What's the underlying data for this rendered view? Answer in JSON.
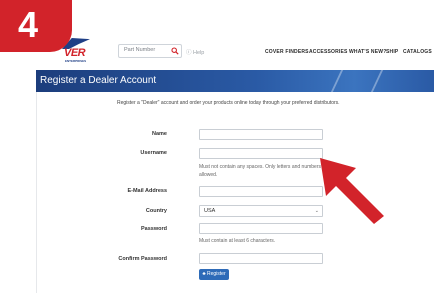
{
  "step": {
    "number": "4"
  },
  "logo": {
    "text": "VER",
    "subtext": "ENTERPRISES"
  },
  "search": {
    "placeholder": "Part Number"
  },
  "help": {
    "label": "Help"
  },
  "nav": {
    "items": [
      "COVER FINDERS",
      "ACCESSORIES",
      "WHAT'S NEW?",
      "SHIP",
      "CATALOGS"
    ]
  },
  "header": {
    "title": "Register a Dealer Account"
  },
  "intro": {
    "text": "Register a \"Dealer\" account and order your products online today through your preferred distributors."
  },
  "form": {
    "name_label": "Name",
    "username_label": "Username",
    "username_hint": "Must not contain any spaces. Only letters and numbers allowed.",
    "email_label": "E-Mail Address",
    "country_label": "Country",
    "country_value": "USA",
    "password_label": "Password",
    "password_hint": "Must contain at least 6 characters.",
    "confirm_label": "Confirm Password",
    "register_label": "♣ Register"
  },
  "colors": {
    "brand_red": "#d2232a",
    "brand_blue": "#1f3f86",
    "band_blue": "#2a5aa5",
    "button_blue": "#2e6bb8"
  }
}
